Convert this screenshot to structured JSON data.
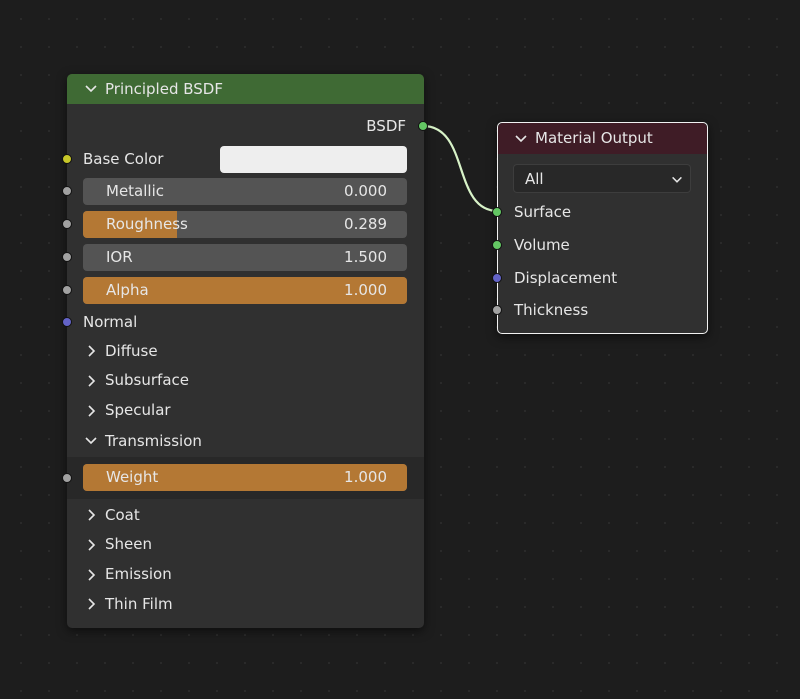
{
  "bsdf_node": {
    "title": "Principled BSDF",
    "output_label": "BSDF",
    "base_color_label": "Base Color",
    "base_color_value": "#eeeeee",
    "fields": [
      {
        "label": "Metallic",
        "value": "0.000",
        "fraction": 0.0
      },
      {
        "label": "Roughness",
        "value": "0.289",
        "fraction": 0.289
      },
      {
        "label": "IOR",
        "value": "1.500",
        "fraction": 0.0
      },
      {
        "label": "Alpha",
        "value": "1.000",
        "fraction": 1.0
      }
    ],
    "normal_label": "Normal",
    "panels_top": [
      "Diffuse",
      "Subsurface",
      "Specular"
    ],
    "transmission_label": "Transmission",
    "weight_field": {
      "label": "Weight",
      "value": "1.000",
      "fraction": 1.0
    },
    "panels_bottom": [
      "Coat",
      "Sheen",
      "Emission",
      "Thin Film"
    ]
  },
  "output_node": {
    "title": "Material Output",
    "target_selected": "All",
    "inputs": [
      "Surface",
      "Volume",
      "Displacement",
      "Thickness"
    ]
  },
  "colors": {
    "shader_header": "#3f6a34",
    "output_header": "#3f1c26",
    "socket_color": "#c7c729",
    "socket_float": "#a1a1a1",
    "socket_vector": "#6363c7",
    "socket_shader": "#63c763",
    "link": "#d8f3c8",
    "field_fill": "#b47834"
  }
}
